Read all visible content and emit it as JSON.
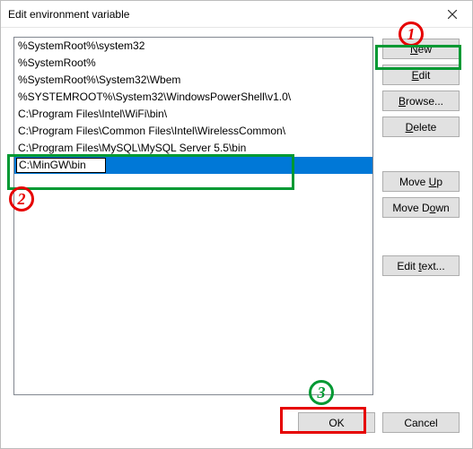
{
  "titlebar": {
    "title": "Edit environment variable",
    "close_icon": "close"
  },
  "list": {
    "items": [
      "%SystemRoot%\\system32",
      "%SystemRoot%",
      "%SystemRoot%\\System32\\Wbem",
      "%SYSTEMROOT%\\System32\\WindowsPowerShell\\v1.0\\",
      "C:\\Program Files\\Intel\\WiFi\\bin\\",
      "C:\\Program Files\\Common Files\\Intel\\WirelessCommon\\",
      "C:\\Program Files\\MySQL\\MySQL Server 5.5\\bin"
    ],
    "editing_value": "C:\\MinGW\\bin"
  },
  "buttons": {
    "new": "New",
    "edit": "Edit",
    "browse": "Browse...",
    "delete": "Delete",
    "moveup": "Move Up",
    "movedown": "Move Down",
    "edittext": "Edit text...",
    "ok": "OK",
    "cancel": "Cancel"
  },
  "annotations": {
    "n1": "1",
    "n2": "2",
    "n3": "3"
  }
}
